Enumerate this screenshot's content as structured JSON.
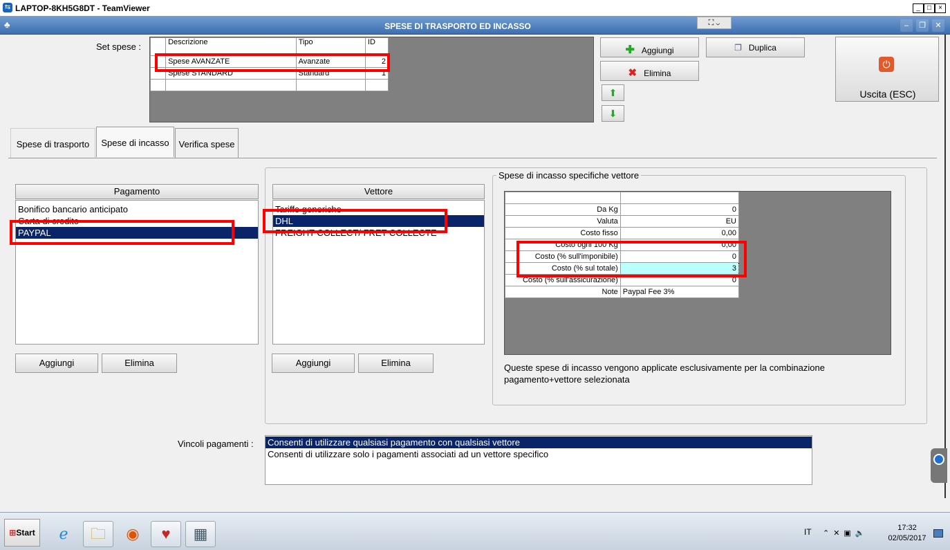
{
  "window": {
    "title": "LAPTOP-8KH5G8DT - TeamViewer",
    "minimize": "_",
    "maximize": "□",
    "close": "×"
  },
  "app": {
    "title": "SPESE DI TRASPORTO ED INCASSO"
  },
  "set_spese": {
    "label": "Set spese :",
    "headers": [
      "Descrizione",
      "Tipo",
      "ID"
    ],
    "rows": [
      {
        "descrizione": "Spese AVANZATE",
        "tipo": "Avanzate",
        "id": "2"
      },
      {
        "descrizione": "Spese STANDARD",
        "tipo": "Standard",
        "id": "1"
      }
    ]
  },
  "actions": {
    "aggiungi": "Aggiungi",
    "elimina": "Elimina",
    "duplica": "Duplica",
    "uscita": "Uscita (ESC)"
  },
  "tabs": [
    "Spese di trasporto",
    "Spese di incasso",
    "Verifica spese"
  ],
  "pagamento": {
    "header": "Pagamento",
    "items": [
      "Bonifico bancario anticipato",
      "Carta di credito",
      "PAYPAL"
    ],
    "selected": 2,
    "aggiungi": "Aggiungi",
    "elimina": "Elimina"
  },
  "vettore": {
    "header": "Vettore",
    "items": [
      "Tariffe generiche",
      "DHL",
      "FREIGHT COLLECT/ FRET COLLECTE"
    ],
    "selected": 1,
    "aggiungi": "Aggiungi",
    "elimina": "Elimina"
  },
  "spese_specifiche": {
    "title": "Spese di incasso specifiche vettore",
    "rows": [
      {
        "label": "Da Kg",
        "value": "0"
      },
      {
        "label": "Valuta",
        "value": "EU"
      },
      {
        "label": "Costo fisso",
        "value": "0,00"
      },
      {
        "label": "Costo ogni 100 Kg",
        "value": "0,00"
      },
      {
        "label": "Costo (% sull'imponibile)",
        "value": "0"
      },
      {
        "label": "Costo (% sul totale)",
        "value": "3"
      },
      {
        "label": "Costo (% sull'assicurazione)",
        "value": "0"
      },
      {
        "label": "Note",
        "value": "Paypal Fee 3%"
      }
    ],
    "note": "Queste spese di incasso vengono applicate esclusivamente per la combinazione pagamento+vettore selezionata"
  },
  "vincoli": {
    "label": "Vincoli pagamenti :",
    "options": [
      "Consenti di utilizzare qualsiasi pagamento con qualsiasi vettore",
      "Consenti di utilizzare solo i pagamenti associati ad un vettore specifico"
    ],
    "selected": 0
  },
  "taskbar": {
    "start": "Start",
    "lang": "IT",
    "time": "17:32",
    "date": "02/05/2017"
  }
}
